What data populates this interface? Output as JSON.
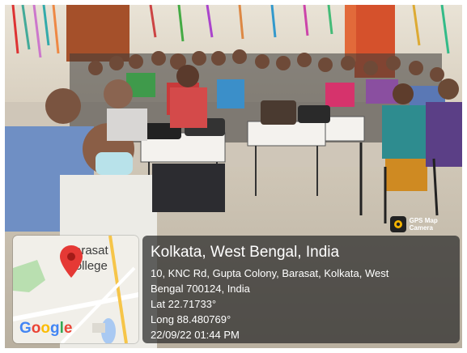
{
  "map": {
    "place_label": [
      "Barasat",
      "College"
    ],
    "logo_text": "Google",
    "pin_icon": "location-pin-icon"
  },
  "watermark": {
    "label": "GPS Map Camera",
    "icon": "gps-map-camera-icon"
  },
  "location": {
    "title": "Kolkata, West Bengal, India",
    "address_line1": "10, KNC Rd, Gupta Colony, Barasat, Kolkata, West",
    "address_line2": "Bengal 700124, India",
    "latitude": "Lat 22.71733°",
    "longitude": "Long 88.480769°",
    "datetime": "22/09/22 01:44 PM"
  },
  "colors": {
    "google_blue": "#4285F4",
    "google_red": "#EA4335",
    "google_yellow": "#FBBC05",
    "google_green": "#34A853",
    "pin_red": "#E53935"
  }
}
